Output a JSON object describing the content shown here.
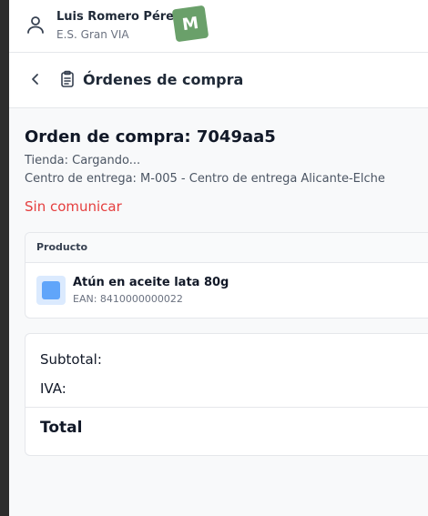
{
  "user": {
    "name": "Luis Romero Pérez",
    "store": "E.S. Gran VIA",
    "avatar_initial": "M",
    "avatar_color": "#6aa06a"
  },
  "header": {
    "title": "Órdenes de compra",
    "icons": [
      "user-icon",
      "chevron-left-icon",
      "clipboard-icon"
    ]
  },
  "order": {
    "title": "Orden de compra: 7049aa5",
    "store_line": "Tienda: Cargando...",
    "delivery_line": "Centro de entrega: M-005 - Centro de entrega Alicante-Elche",
    "status": "Sin comunicar",
    "status_color": "#e53e3e"
  },
  "products": {
    "column_header": "Producto",
    "items": [
      {
        "name": "Atún en aceite lata 80g",
        "ean": "EAN: 8410000000022"
      }
    ]
  },
  "totals": {
    "subtotal_label": "Subtotal:",
    "iva_label": "IVA:",
    "total_label": "Total"
  }
}
